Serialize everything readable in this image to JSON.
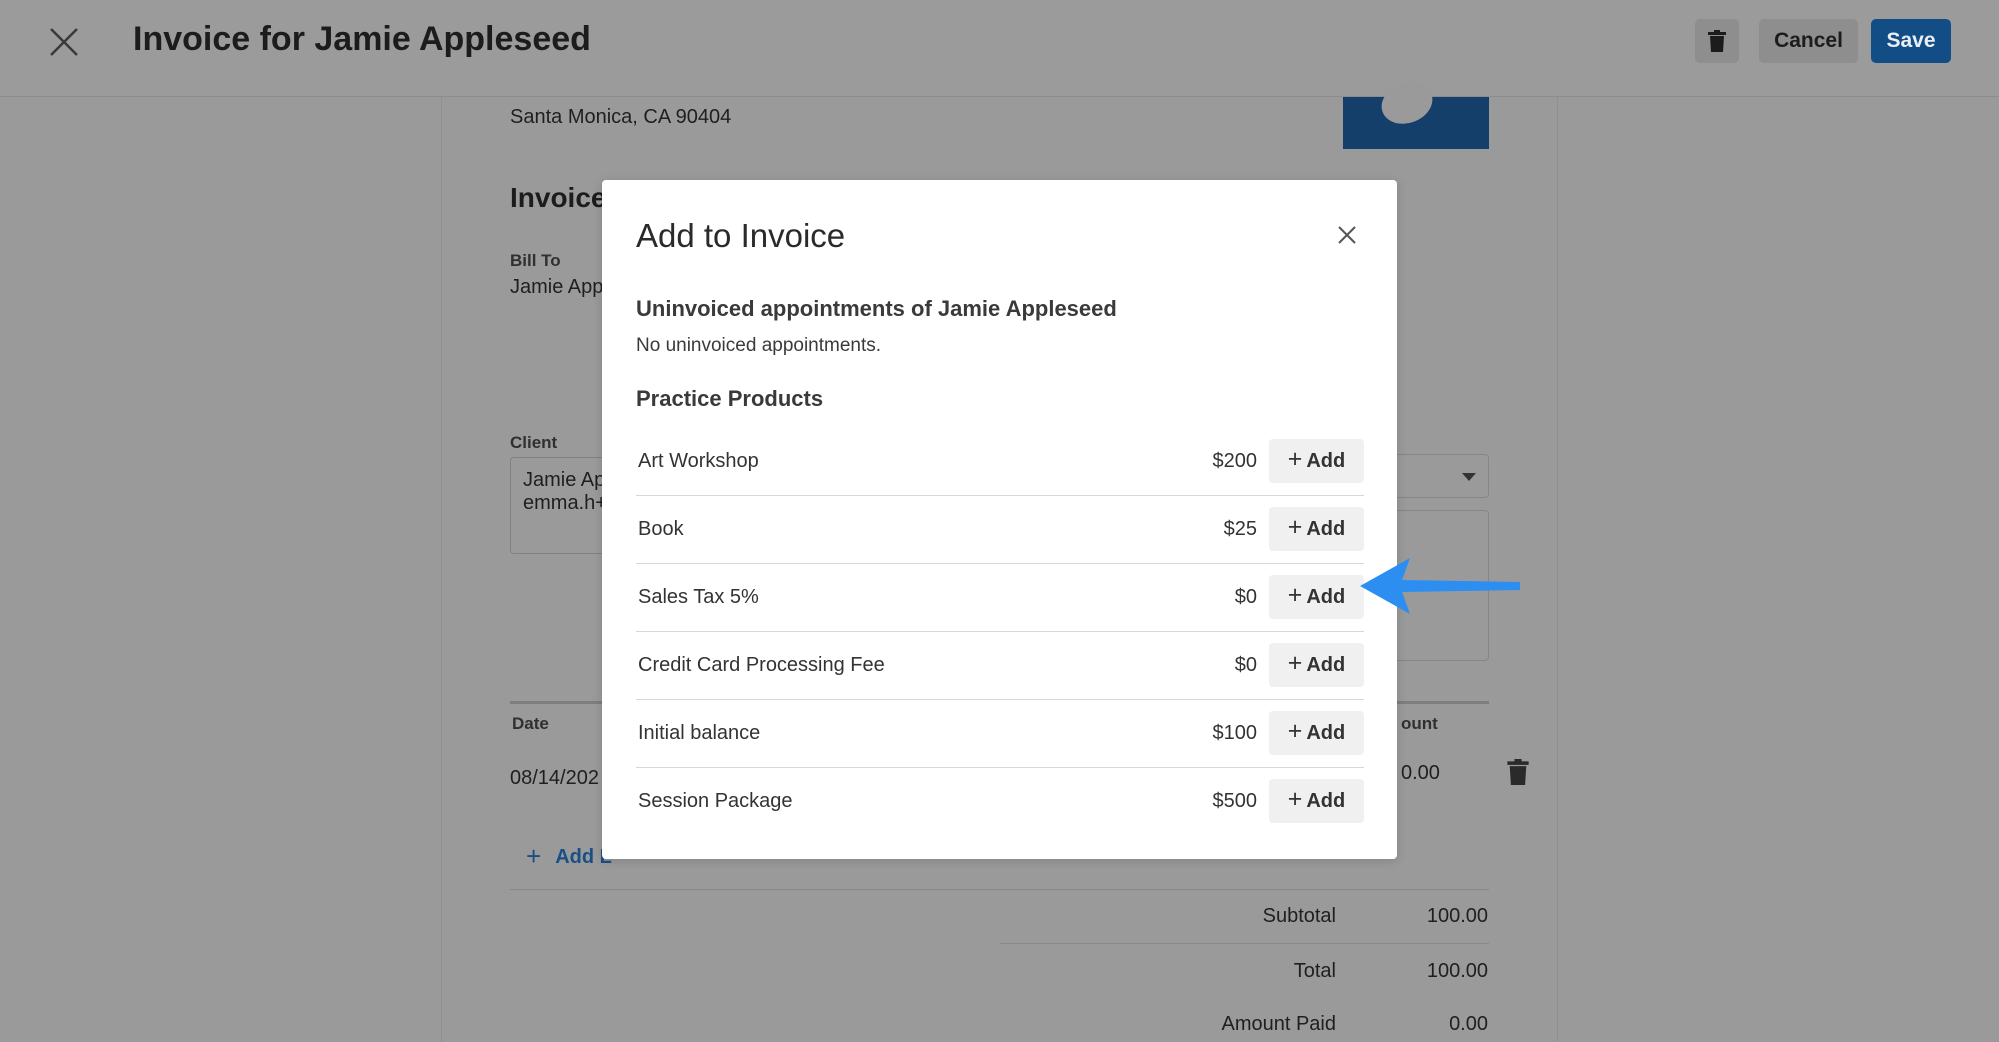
{
  "header": {
    "title": "Invoice for Jamie Appleseed",
    "cancel_label": "Cancel",
    "save_label": "Save"
  },
  "document": {
    "address_line": "Santa Monica, CA 90404",
    "heading_partial": "Invoice",
    "bill_to_label": "Bill To",
    "bill_to_value_partial": "Jamie App",
    "client_label": "Client",
    "client_name_partial": "Jamie Ap",
    "client_email_partial": "emma.h+",
    "table": {
      "date_header": "Date",
      "amount_header_partial": "ount",
      "row_date_partial": "08/14/202",
      "row_amount_partial": "0.00"
    },
    "add_line_item_partial": "Add L",
    "totals": {
      "subtotal_label": "Subtotal",
      "subtotal_value": "100.00",
      "total_label": "Total",
      "total_value": "100.00",
      "amount_paid_label": "Amount Paid",
      "amount_paid_value": "0.00"
    }
  },
  "modal": {
    "title": "Add to Invoice",
    "uninvoiced_heading": "Uninvoiced appointments of Jamie Appleseed",
    "uninvoiced_text": "No uninvoiced appointments.",
    "products_heading": "Practice Products",
    "add_label": "Add",
    "products": [
      {
        "name": "Art Workshop",
        "price": "$200"
      },
      {
        "name": "Book",
        "price": "$25"
      },
      {
        "name": "Sales Tax 5%",
        "price": "$0"
      },
      {
        "name": "Credit Card Processing Fee",
        "price": "$0"
      },
      {
        "name": "Initial balance",
        "price": "$100"
      },
      {
        "name": "Session Package",
        "price": "$500"
      }
    ]
  },
  "colors": {
    "overlay": "#9a9a9a",
    "save_button": "#134d86",
    "pointer_arrow": "#2b8ef0"
  },
  "icons": [
    "close-icon",
    "trash-icon",
    "plus-icon",
    "dropdown-caret-icon",
    "pointer-arrow-icon"
  ]
}
